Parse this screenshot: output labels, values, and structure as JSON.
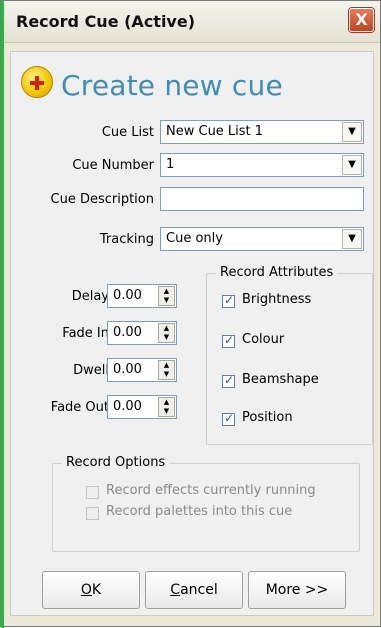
{
  "window": {
    "title": "Record Cue (Active)",
    "close_label": "X"
  },
  "heading": "Create new cue",
  "fields": {
    "cue_list": {
      "label": "Cue List",
      "value": "New Cue List 1"
    },
    "cue_number": {
      "label": "Cue Number",
      "value": "1"
    },
    "cue_description": {
      "label": "Cue Description",
      "value": ""
    },
    "tracking": {
      "label": "Tracking",
      "value": "Cue only"
    }
  },
  "timing": {
    "delay": {
      "label": "Delay",
      "value": "0.00"
    },
    "fade_in": {
      "label": "Fade In",
      "value": "0.00"
    },
    "dwell": {
      "label": "Dwell",
      "value": "0.00"
    },
    "fade_out": {
      "label": "Fade Out",
      "value": "0.00"
    }
  },
  "record_attributes": {
    "title": "Record Attributes",
    "items": [
      {
        "label": "Brightness",
        "checked": true
      },
      {
        "label": "Colour",
        "checked": true
      },
      {
        "label": "Beamshape",
        "checked": true
      },
      {
        "label": "Position",
        "checked": true
      }
    ]
  },
  "record_options": {
    "title": "Record Options",
    "items": [
      {
        "label": "Record effects currently running",
        "checked": false,
        "enabled": false
      },
      {
        "label": "Record palettes into this cue",
        "checked": false,
        "enabled": false
      }
    ]
  },
  "buttons": {
    "ok": {
      "prefix": "",
      "accel": "O",
      "rest": "K"
    },
    "cancel": {
      "prefix": "",
      "accel": "C",
      "rest": "ancel"
    },
    "more": "More >>"
  },
  "icons": {
    "heading": "add-icon",
    "dropdown": "chevron-down-icon",
    "spinner": "up-down-arrows-icon"
  },
  "colors": {
    "heading": "#3f8db7",
    "title_close": "#c2411d",
    "window_accent": "#1bbf32"
  }
}
